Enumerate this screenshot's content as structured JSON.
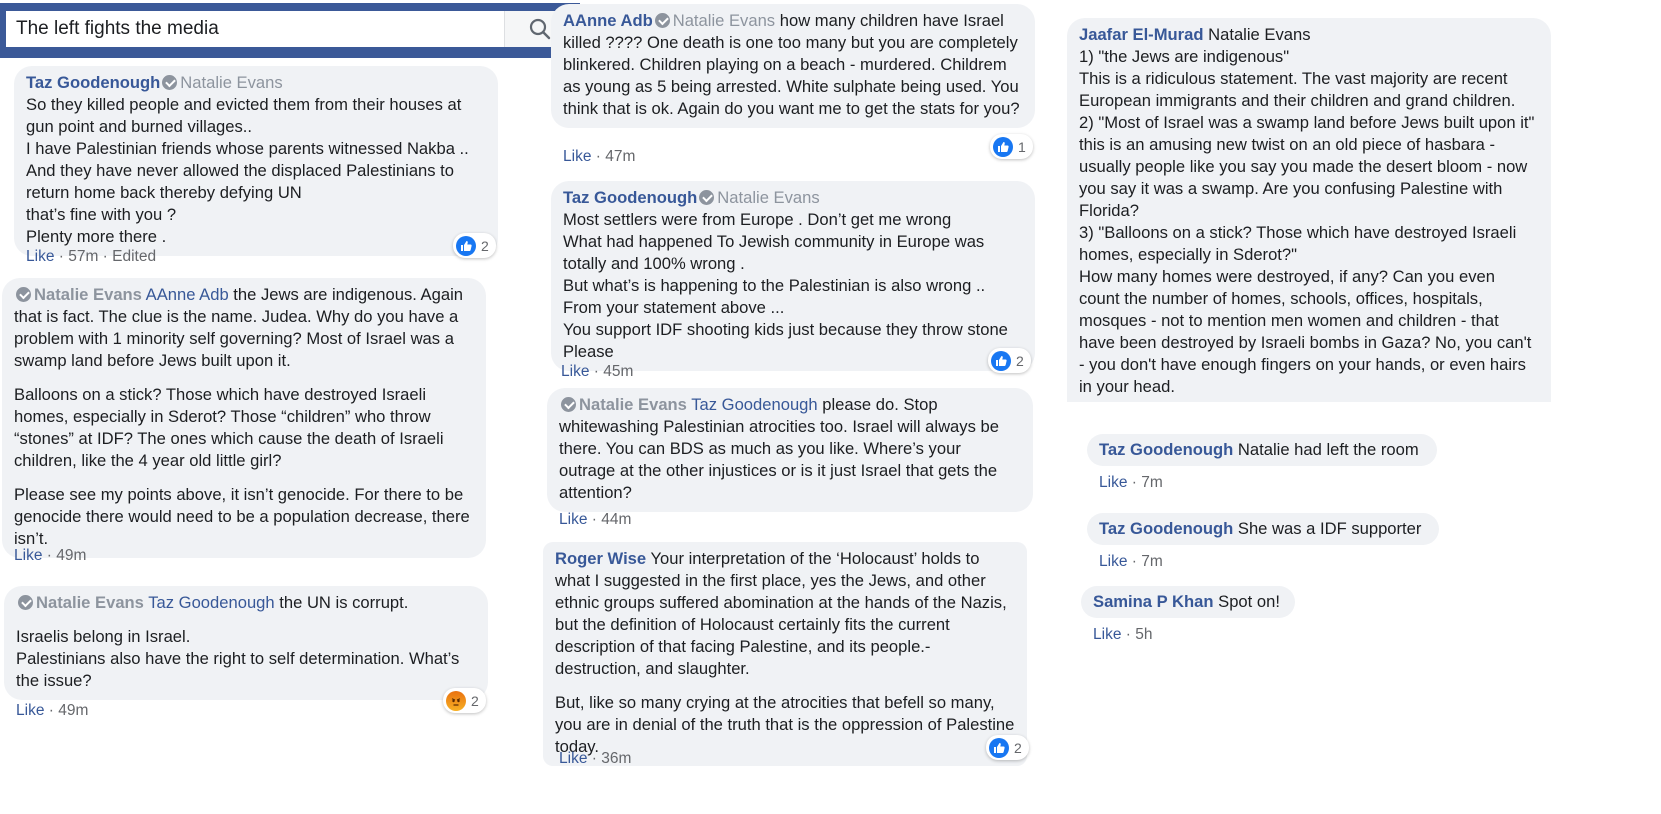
{
  "search": {
    "value": "The left fights the media"
  },
  "common": {
    "like": "Like",
    "sep": " · ",
    "edited": "Edited"
  },
  "comments": {
    "c1": {
      "author": "Taz Goodenough",
      "reply_to": "Natalie Evans",
      "lines": [
        "So they killed people and evicted them from their houses at gun point and burned villages..",
        "I have Palestinian friends whose parents witnessed Nakba ..",
        "And they have never allowed the displaced Palestinians to return home back thereby defying UN",
        "that’s fine with you ?",
        "Plenty more there ."
      ],
      "time": "57m",
      "reactions": "2"
    },
    "c2": {
      "author": "Natalie Evans",
      "tag": "AAnne Adb",
      "p1": "the Jews are indigenous. Again that is fact. The clue is the name. Judea. Why do you have a problem with 1 minority self governing? Most of Israel was a swamp land before Jews built upon it.",
      "p2": "Balloons on a stick? Those which have destroyed Israeli homes, especially in Sderot? Those “children” who throw “stones” at IDF? The ones which cause the death of Israeli children, like the 4 year old little girl?",
      "p3": "Please see my points above, it isn’t genocide. For there to be genocide there would need to be a population decrease, there isn’t.",
      "time": "49m"
    },
    "c3": {
      "author": "Natalie Evans",
      "tag": "Taz Goodenough",
      "p1": "the UN is corrupt.",
      "p2a": "Israelis belong in Israel.",
      "p2b": "Palestinians also have the right to self determination. What’s the issue?",
      "time": "49m",
      "reactions": "2"
    },
    "c4": {
      "author": "AAnne Adb",
      "reply_to": "Natalie Evans",
      "text": "how many children have Israel killed ???? One death is one too many but you are completely blinkered. Children playing on a beach - murdered. Childrem as young as 5 being arrested. White sulphate being used. You think that is ok. Again do you want me to get the stats for you?",
      "time": "47m",
      "reactions": "1"
    },
    "c5": {
      "author": "Taz Goodenough",
      "reply_to": "Natalie Evans",
      "lines": [
        "Most settlers were from Europe . Don’t get me wrong",
        "What had happened To Jewish community in Europe was totally and 100% wrong .",
        "But what’s is happening to the Palestinian is also wrong ..",
        "From your statement above ...",
        "You support IDF shooting kids just because they throw stone Please"
      ],
      "time": "45m",
      "reactions": "2"
    },
    "c6": {
      "author": "Natalie Evans",
      "tag": "Taz Goodenough",
      "text": "please do. Stop whitewashing Palestinian atrocities too. Israel will always be there. You can BDS as much as you like. Where’s your outrage at the other injustices or is it just Israel that gets the attention?",
      "time": "44m"
    },
    "c7": {
      "author": "Roger Wise",
      "text": "Your interpretation of the ‘Holocaust’ holds to what I suggested in the first place, yes the Jews, and other ethnic groups suffered abomination at the hands of the Nazis, but the definition of Holocaust certainly fits the current description of that facing Palestine, and its people.- destruction, and slaughter.",
      "text2": "But, like so many crying at the atrocities that befell so many, you are in denial of the truth that is the oppression of Palestine today.",
      "time": "36m",
      "reactions": "2"
    },
    "c8": {
      "author": "Jaafar El-Murad",
      "reply_to": "Natalie Evans",
      "lines": [
        "1) \"the Jews are indigenous\"",
        "This is a ridiculous statement. The vast majority are recent European immigrants and their children and grand children.",
        "2) \"Most of Israel was a swamp land before Jews built upon it\"",
        "this is an amusing new twist on an old piece of hasbara - usually people like you say you made the desert bloom - now you say it was a swamp. Are you confusing Palestine with Florida?",
        "3) \"Balloons on a stick? Those which have destroyed Israeli homes, especially in Sderot?\"",
        "How many homes were destroyed, if any? Can you even count the number of homes, schools, offices, hospitals, mosques - not to mention men women and children - that have been destroyed by Israeli bombs in Gaza? No, you can't - you don't have enough fingers on your hands, or even hairs in your head."
      ]
    },
    "c9": {
      "author": "Taz Goodenough",
      "text": "Natalie had left the room",
      "time": "7m"
    },
    "c10": {
      "author": "Taz Goodenough",
      "text": "She was a IDF supporter",
      "time": "7m"
    },
    "c11": {
      "author": "Samina P Khan",
      "text": "Spot on!",
      "time": "5h"
    }
  }
}
